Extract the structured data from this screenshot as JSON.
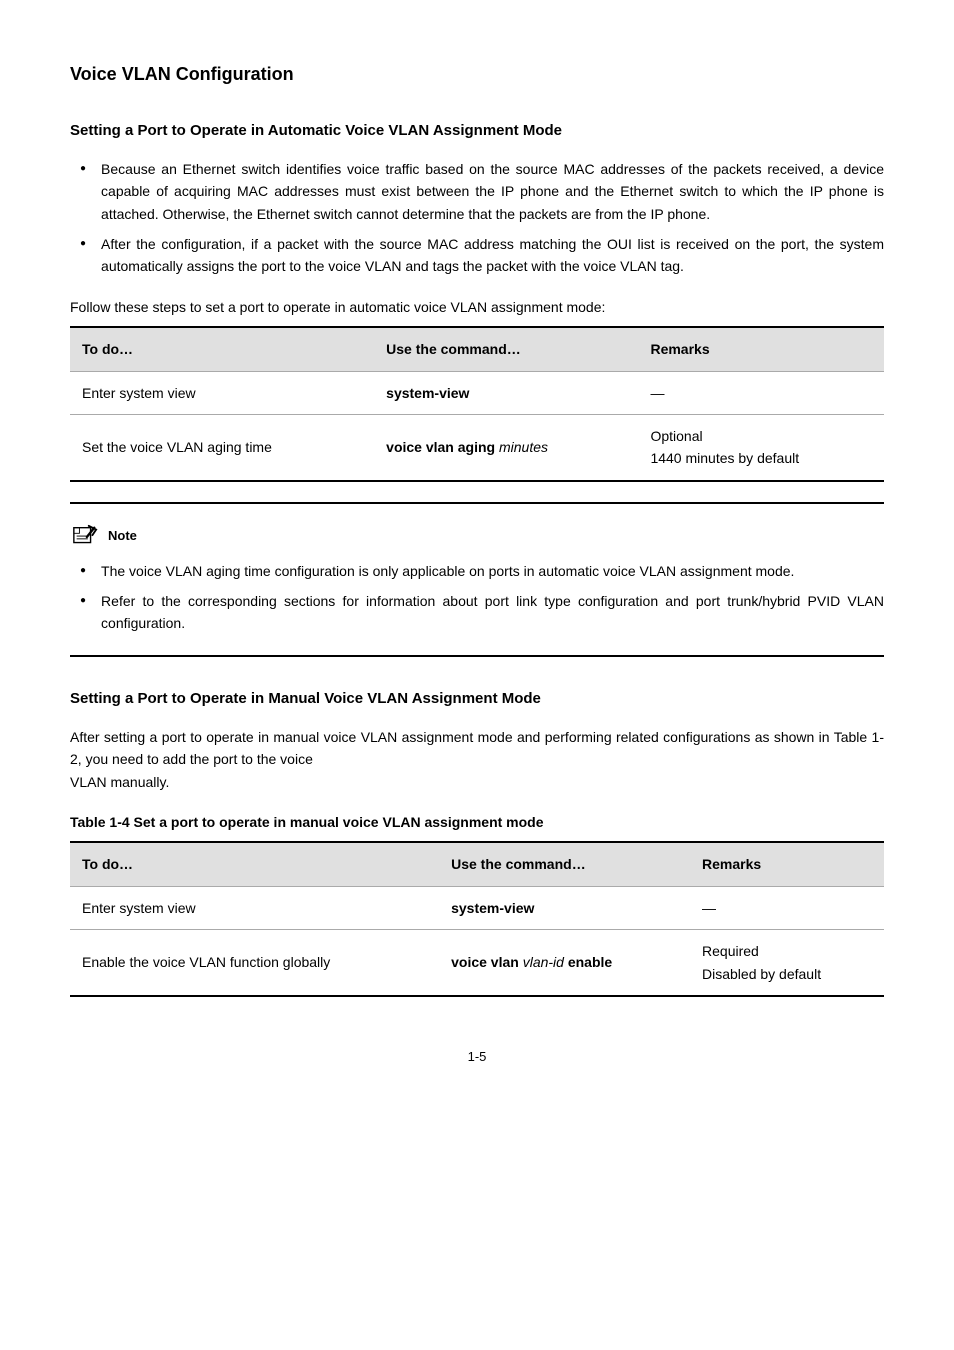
{
  "heading": "Voice VLAN Configuration",
  "section1": {
    "title": "Setting a Port to Operate in Automatic Voice VLAN Assignment Mode",
    "bullets": [
      "Because an Ethernet switch identifies voice traffic based on the source MAC addresses of the packets received, a device capable of acquiring MAC addresses must exist between the IP phone and the Ethernet switch to which the IP phone is attached. Otherwise, the Ethernet switch cannot determine that the packets are from the IP phone.",
      "After the configuration, if a packet with the source MAC address matching the OUI list is received on the port, the system automatically assigns the port to the voice VLAN and tags the packet with the voice VLAN tag."
    ],
    "tableCaption": "Follow these steps to set a port to operate in automatic voice VLAN assignment mode:",
    "tableHeaders": [
      "To do…",
      "Use the command…",
      "Remarks"
    ],
    "tableRows": [
      [
        "Enter system view",
        "system-view",
        "—"
      ],
      [
        "Set the voice VLAN aging time",
        "voice vlan aging minutes",
        "Optional\n1440 minutes by default"
      ]
    ]
  },
  "note": {
    "label": "Note",
    "bullets": [
      "The voice VLAN aging time configuration is only applicable on ports in automatic voice VLAN assignment mode.",
      "Refer to the corresponding sections for information about port link type configuration and port trunk/hybrid PVID VLAN configuration."
    ]
  },
  "section2": {
    "title": "Setting a Port to Operate in Manual Voice VLAN Assignment Mode",
    "intro": "After setting a port to operate in manual voice VLAN assignment mode and performing related configurations as shown in ",
    "tableRef1": "Table 1-2",
    "intro2": ", you need to add the port to the voice\nVLAN manually.",
    "tableCaption": "Table 1-4 Set a port to operate in manual voice VLAN assignment mode",
    "tableHeaders": [
      "To do…",
      "Use the command…",
      "Remarks"
    ],
    "tableRows": [
      [
        "Enter system view",
        "system-view",
        "—"
      ],
      [
        "Enable the voice VLAN function globally",
        "voice vlan vlan-id enable",
        "Required\nDisabled by default"
      ]
    ]
  },
  "pageNumber": "1-5"
}
